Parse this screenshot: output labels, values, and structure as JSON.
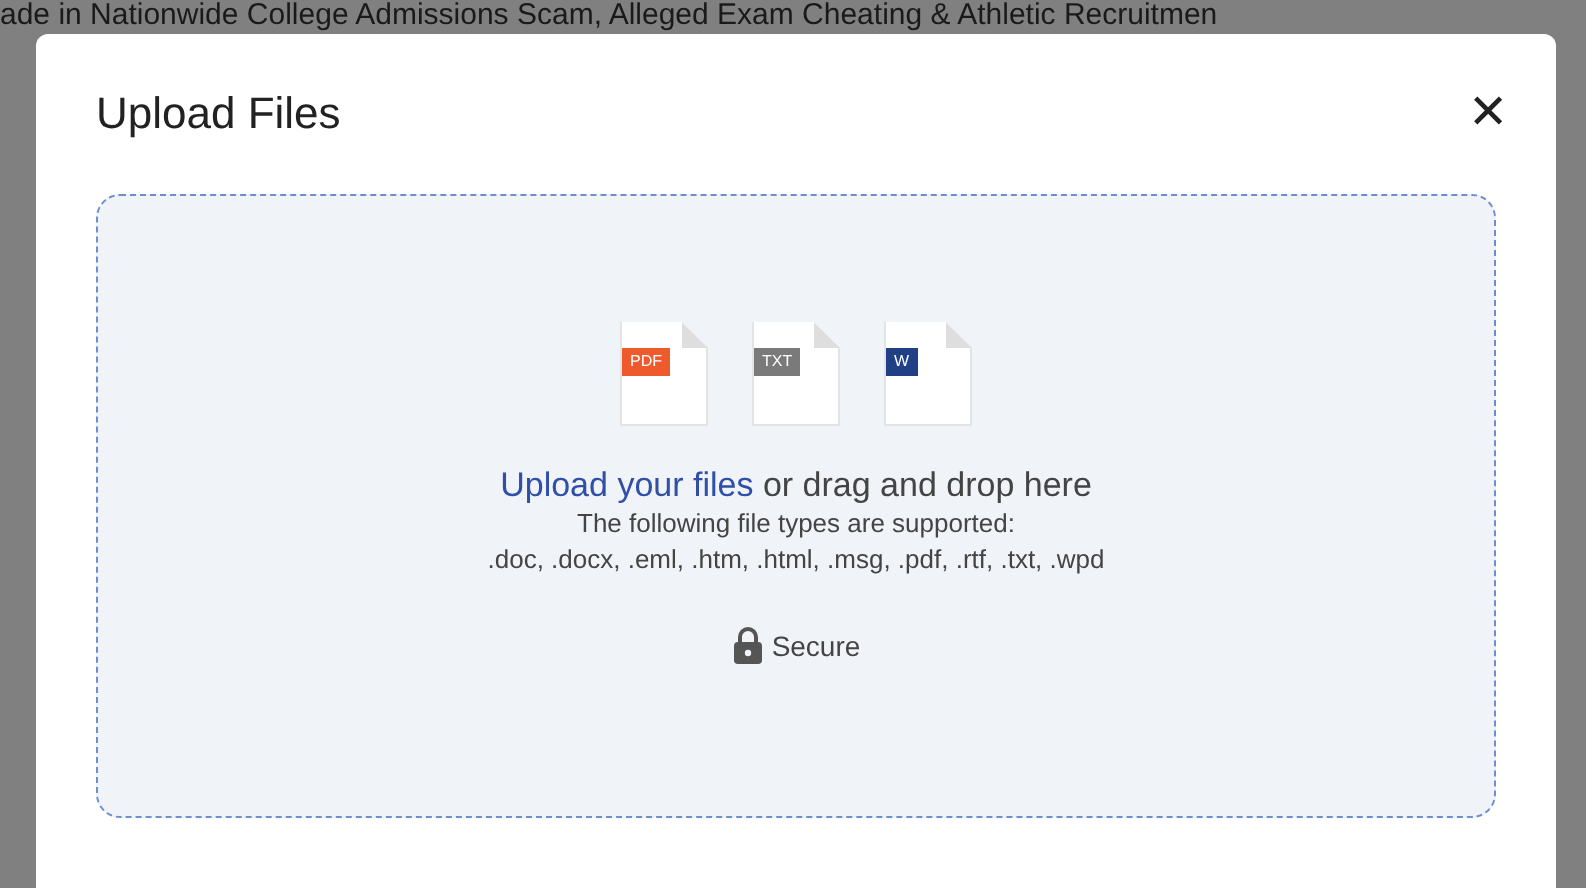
{
  "background_headline": "ade in Nationwide College Admissions Scam, Alleged Exam Cheating & Athletic Recruitmen",
  "dialog": {
    "title": "Upload Files",
    "close": "✕",
    "file_icons": [
      {
        "label": "PDF",
        "color": "#ee5a2c"
      },
      {
        "label": "TXT",
        "color": "#7a7a7a"
      },
      {
        "label": "W",
        "color": "#203f84"
      }
    ],
    "upload_link": "Upload your files",
    "drop_text": "or drag and drop here",
    "supported_label": "The following file types are supported:",
    "supported_types": ".doc, .docx, .eml, .htm, .html, .msg, .pdf, .rtf, .txt, .wpd",
    "secure_label": "Secure"
  }
}
